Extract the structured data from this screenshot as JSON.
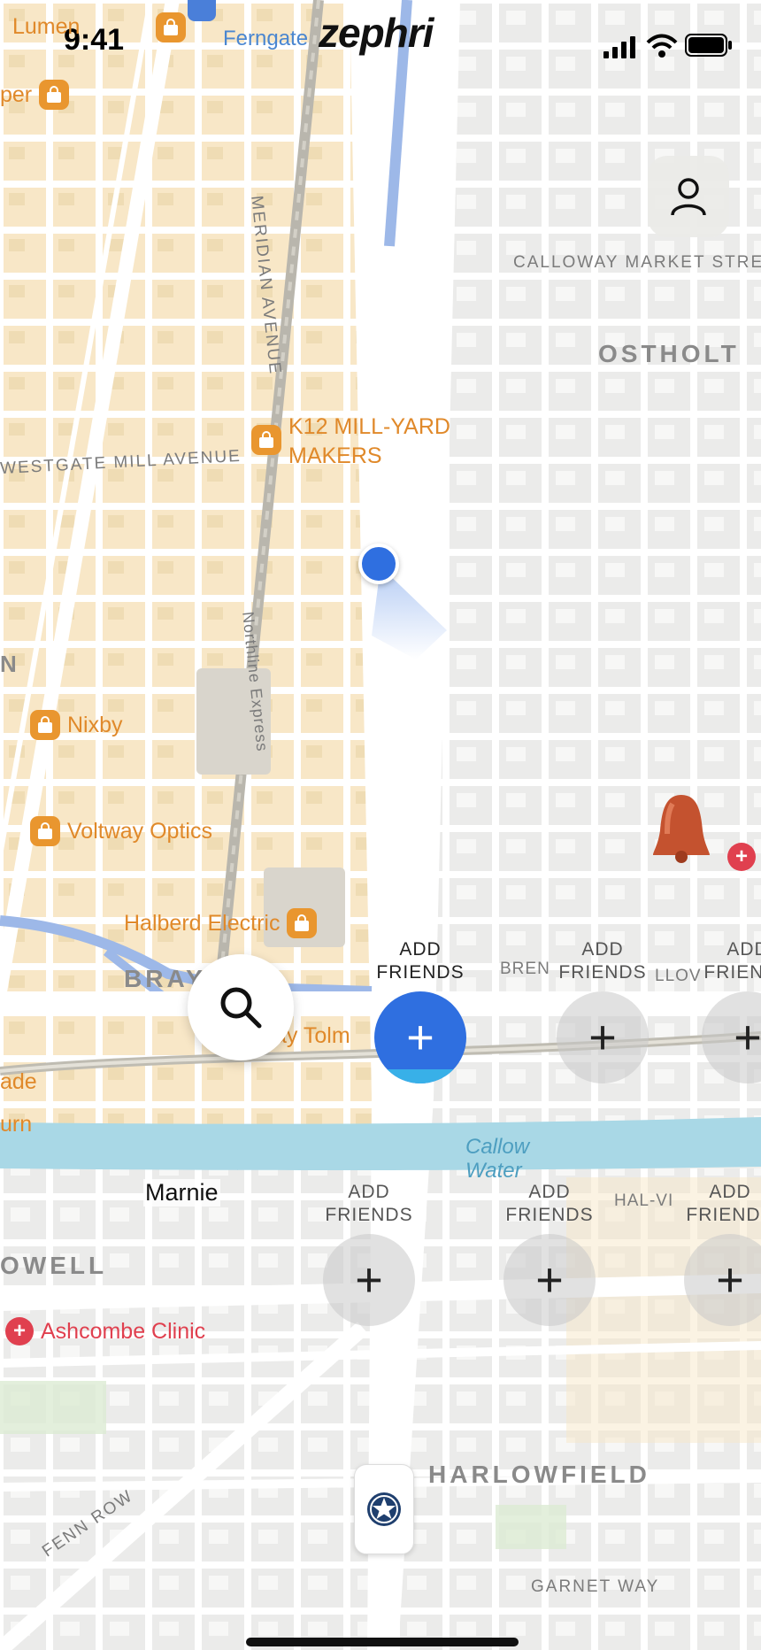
{
  "status_bar": {
    "time": "9:41"
  },
  "app": {
    "logo_text": "zephri"
  },
  "map": {
    "top_labels": {
      "lumen": "Lumen",
      "ferngate": "Ferngate",
      "per": "per"
    },
    "streets": {
      "meridian": "MERIDIAN AVENUE",
      "calloway": "CALLOWAY MARKET STRE",
      "westgate": "WESTGATE MILL AVENUE",
      "northline": "Northline Express",
      "fenn_row": "FENN ROW",
      "garnet": "GARNET WAY",
      "bren": "BREN",
      "llov": "LLOV",
      "hal": "HAL-VI"
    },
    "districts": {
      "ostholt": "OSTHOLT",
      "bray": "BRAY",
      "owell": "OWELL",
      "harlowfield": "HARLOWFIELD",
      "n": "N"
    },
    "pois": {
      "k12_line1": "K12 MILL-YARD",
      "k12_line2": "MAKERS",
      "nixby": "Nixby",
      "voltway": "Voltway Optics",
      "halberd": "Halberd Electric",
      "tolm": "ay Tolm",
      "ade": "ade",
      "urn": "urn",
      "clinic": "Ashcombe Clinic"
    },
    "water": {
      "line1": "Callow",
      "line2": "Water"
    }
  },
  "friends": {
    "add_label_line1": "ADD",
    "add_label_line2": "FRIENDS",
    "named_friend": "Marnie"
  },
  "colors": {
    "accent": "#2f6fe0",
    "map_bg": "#f2f0ec",
    "water": "#a9d8e6",
    "poi": "#e0892a"
  }
}
